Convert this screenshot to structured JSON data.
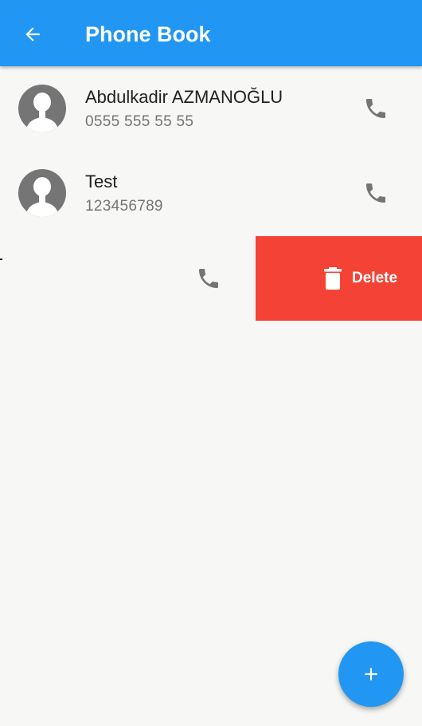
{
  "appbar": {
    "title": "Phone Book",
    "back_icon": "arrow-back-icon",
    "color": "#2196f3"
  },
  "contacts": [
    {
      "name": "Abdulkadir AZMANOĞLU",
      "phone": "0555 555 55 55",
      "avatar_icon": "person-avatar-icon",
      "call_icon": "phone-icon"
    },
    {
      "name": "Test",
      "phone": "123456789",
      "avatar_icon": "person-avatar-icon",
      "call_icon": "phone-icon"
    }
  ],
  "swipe_row": {
    "call_icon": "phone-icon",
    "delete_label": "Delete",
    "delete_icon": "trash-icon",
    "delete_color": "#f44336"
  },
  "fab": {
    "icon": "plus-icon",
    "color": "#2196f3"
  }
}
